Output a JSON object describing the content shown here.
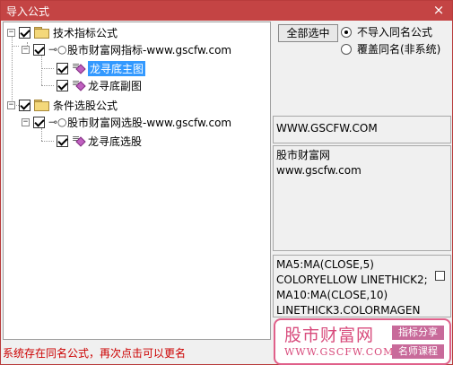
{
  "window": {
    "title": "导入公式",
    "close": "×"
  },
  "tree": {
    "nodes": [
      {
        "label": "技术指标公式"
      },
      {
        "label": "股市财富网指标-www.gscfw.com"
      },
      {
        "label": "龙寻底主图"
      },
      {
        "label": "龙寻底副图"
      },
      {
        "label": "条件选股公式"
      },
      {
        "label": "股市财富网选股-www.gscfw.com"
      },
      {
        "label": "龙寻底选股"
      }
    ]
  },
  "right": {
    "select_all": "全部选中",
    "radio1": "不导入同名公式",
    "radio2": "覆盖同名(非系统)",
    "url_box": "WWW.GSCFW.COM",
    "desc_line1": "股市财富网",
    "desc_line2": "www.gscfw.com",
    "code_line1": "MA5:MA(CLOSE,5)",
    "code_line2": "COLORYELLOW LINETHICK2;",
    "code_line3": "MA10:MA(CLOSE,10)",
    "code_line4": "LINETHICK3.COLORMAGEN"
  },
  "status": "系统存在同名公式，再次点击可以更名",
  "watermark": {
    "title": "股市财富网",
    "url": "WWW.GSCFW.COM",
    "tag1": "指标分享",
    "tag2": "名师课程"
  }
}
